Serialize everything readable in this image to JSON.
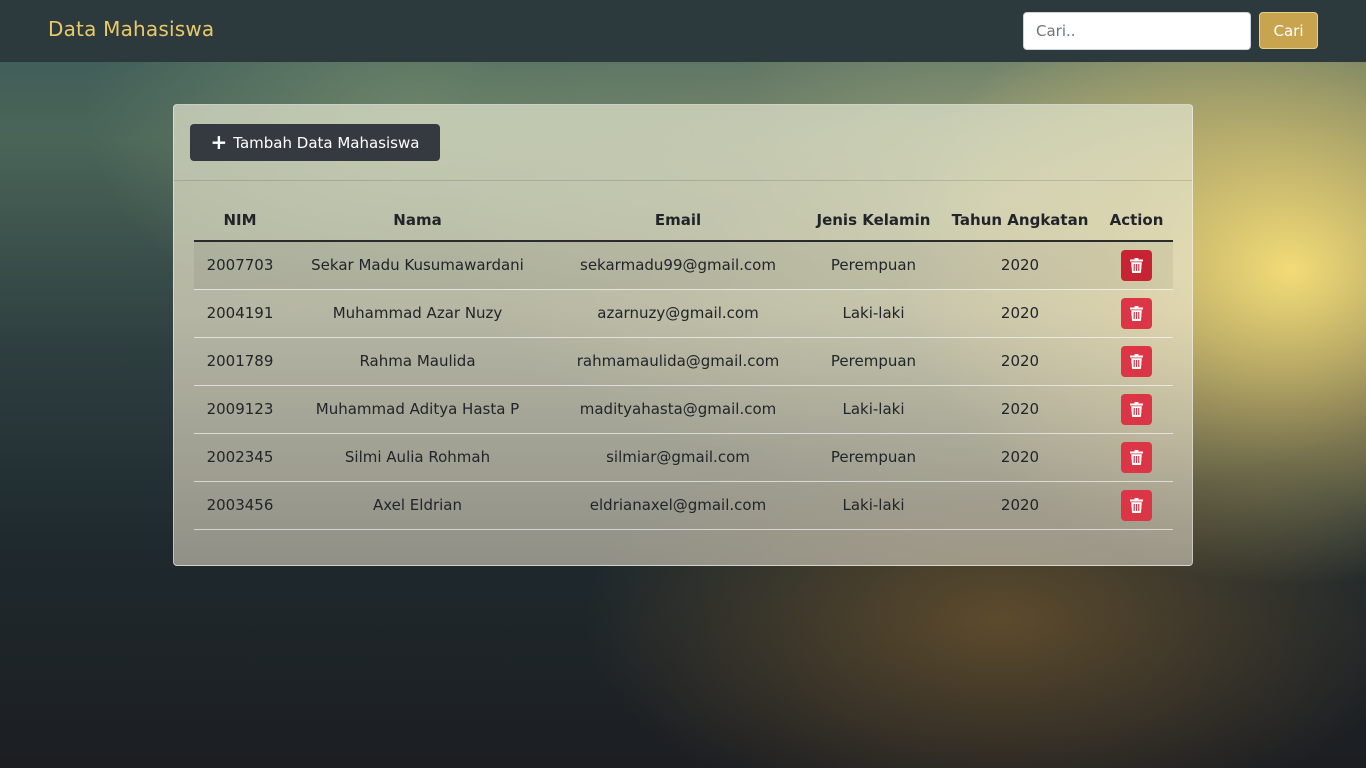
{
  "navbar": {
    "brand": "Data Mahasiswa",
    "search_placeholder": "Cari..",
    "search_value": "",
    "search_button": "Cari"
  },
  "card": {
    "add_button": "Tambah Data Mahasiswa"
  },
  "table": {
    "headers": {
      "nim": "NIM",
      "nama": "Nama",
      "email": "Email",
      "jenis_kelamin": "Jenis Kelamin",
      "tahun_angkatan": "Tahun Angkatan",
      "action": "Action"
    },
    "rows": [
      {
        "nim": "2007703",
        "nama": "Sekar Madu Kusumawardani",
        "email": "sekarmadu99@gmail.com",
        "jenis_kelamin": "Perempuan",
        "tahun_angkatan": "2020"
      },
      {
        "nim": "2004191",
        "nama": "Muhammad Azar Nuzy",
        "email": "azarnuzy@gmail.com",
        "jenis_kelamin": "Laki-laki",
        "tahun_angkatan": "2020"
      },
      {
        "nim": "2001789",
        "nama": "Rahma Maulida",
        "email": "rahmamaulida@gmail.com",
        "jenis_kelamin": "Perempuan",
        "tahun_angkatan": "2020"
      },
      {
        "nim": "2009123",
        "nama": "Muhammad Aditya Hasta P",
        "email": "madityahasta@gmail.com",
        "jenis_kelamin": "Laki-laki",
        "tahun_angkatan": "2020"
      },
      {
        "nim": "2002345",
        "nama": "Silmi Aulia Rohmah",
        "email": "silmiar@gmail.com",
        "jenis_kelamin": "Perempuan",
        "tahun_angkatan": "2020"
      },
      {
        "nim": "2003456",
        "nama": "Axel Eldrian",
        "email": "eldrianaxel@gmail.com",
        "jenis_kelamin": "Laki-laki",
        "tahun_angkatan": "2020"
      }
    ]
  },
  "icons": {
    "add": "plus-icon",
    "delete": "trash-icon"
  },
  "colors": {
    "brand": "#e9c96a",
    "navbar": "#2d3a3d",
    "search_button": "#c9a44e",
    "add_button": "#343a40",
    "delete_button": "#dc3545"
  }
}
